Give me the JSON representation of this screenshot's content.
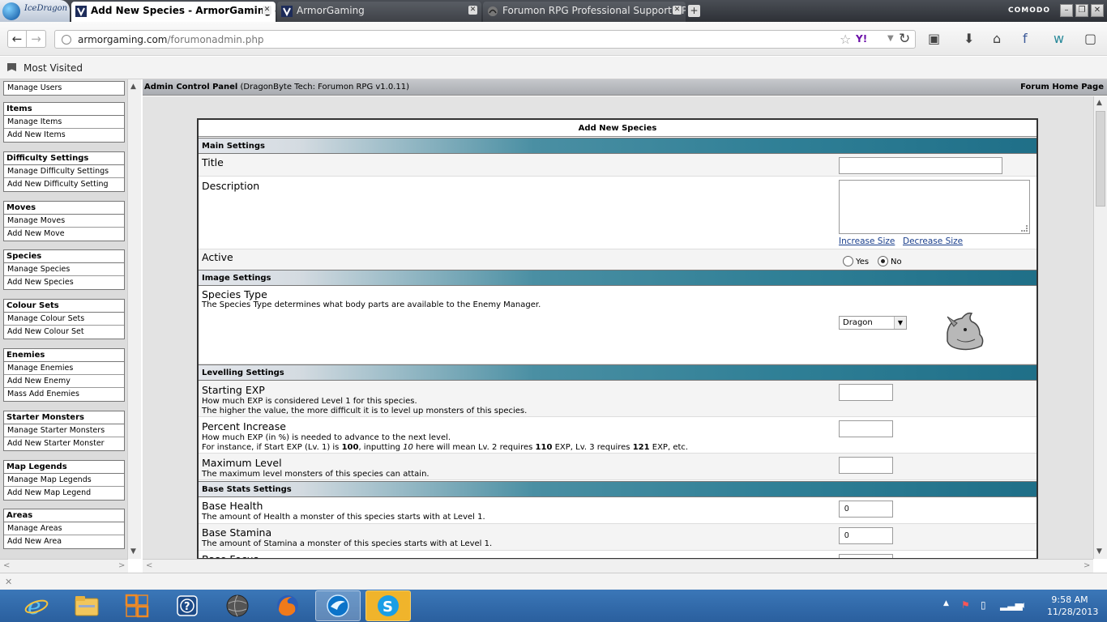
{
  "browser": {
    "brand_label": "IceDragon",
    "tabs": [
      {
        "title": "Add New Species - ArmorGaming - ..."
      },
      {
        "title": "ArmorGaming"
      },
      {
        "title": "Forumon RPG Professional Support - P..."
      }
    ],
    "newtab_label": "+",
    "security_label": "COMODO",
    "url_host": "armorgaming.com",
    "url_path": "/forumonadmin.php",
    "bookmarks_label": "Most Visited"
  },
  "header": {
    "title": "Admin Control Panel",
    "subtitle": "(DragonByte Tech: Forumon RPG v1.0.11)",
    "home_link": "Forum Home Page"
  },
  "sidebar": {
    "groups": [
      {
        "header": "",
        "links": [
          "Manage Users"
        ]
      },
      {
        "header": "Items",
        "links": [
          "Manage Items",
          "Add New Items"
        ]
      },
      {
        "header": "Difficulty Settings",
        "links": [
          "Manage Difficulty Settings",
          "Add New Difficulty Setting"
        ]
      },
      {
        "header": "Moves",
        "links": [
          "Manage Moves",
          "Add New Move"
        ]
      },
      {
        "header": "Species",
        "links": [
          "Manage Species",
          "Add New Species"
        ]
      },
      {
        "header": "Colour Sets",
        "links": [
          "Manage Colour Sets",
          "Add New Colour Set"
        ]
      },
      {
        "header": "Enemies",
        "links": [
          "Manage Enemies",
          "Add New Enemy",
          "Mass Add Enemies"
        ]
      },
      {
        "header": "Starter Monsters",
        "links": [
          "Manage Starter Monsters",
          "Add New Starter Monster"
        ]
      },
      {
        "header": "Map Legends",
        "links": [
          "Manage Map Legends",
          "Add New Map Legend"
        ]
      },
      {
        "header": "Areas",
        "links": [
          "Manage Areas",
          "Add New Area"
        ]
      }
    ]
  },
  "form": {
    "title": "Add New Species",
    "sections": {
      "main": "Main Settings",
      "image": "Image Settings",
      "levelling": "Levelling Settings",
      "base_stats": "Base Stats Settings"
    },
    "title_field": {
      "label": "Title",
      "value": ""
    },
    "description_field": {
      "label": "Description",
      "value": "",
      "increase_label": "Increase Size",
      "decrease_label": "Decrease Size"
    },
    "active_field": {
      "label": "Active",
      "yes_label": "Yes",
      "no_label": "No",
      "selected": "No"
    },
    "species_type": {
      "label": "Species Type",
      "description": "The Species Type determines what body parts are available to the Enemy Manager.",
      "selected": "Dragon"
    },
    "starting_exp": {
      "label": "Starting EXP",
      "desc_line1": "How much EXP is considered Level 1 for this species.",
      "desc_line2": "The higher the value, the more difficult it is to level up monsters of this species.",
      "value": ""
    },
    "percent_increase": {
      "label": "Percent Increase",
      "desc_line1": "How much EXP (in %) is needed to advance to the next level.",
      "desc_line2_a": "For instance, if Start EXP (Lv. 1) is ",
      "desc_line2_b": "100",
      "desc_line2_c": ", inputting ",
      "desc_line2_d": "10",
      "desc_line2_e": " here will mean Lv. 2 requires ",
      "desc_line2_f": "110",
      "desc_line2_g": " EXP, Lv. 3 requires ",
      "desc_line2_h": "121",
      "desc_line2_i": " EXP, etc.",
      "value": ""
    },
    "maximum_level": {
      "label": "Maximum Level",
      "description": "The maximum level monsters of this species can attain.",
      "value": ""
    },
    "base_health": {
      "label": "Base Health",
      "description": "The amount of Health a monster of this species starts with at Level 1.",
      "value": "0"
    },
    "base_stamina": {
      "label": "Base Stamina",
      "description": "The amount of Stamina a monster of this species starts with at Level 1.",
      "value": "0"
    },
    "base_focus": {
      "label": "Base Focus"
    }
  },
  "taskbar": {
    "clock_time": "9:58 AM",
    "clock_date": "11/28/2013"
  }
}
